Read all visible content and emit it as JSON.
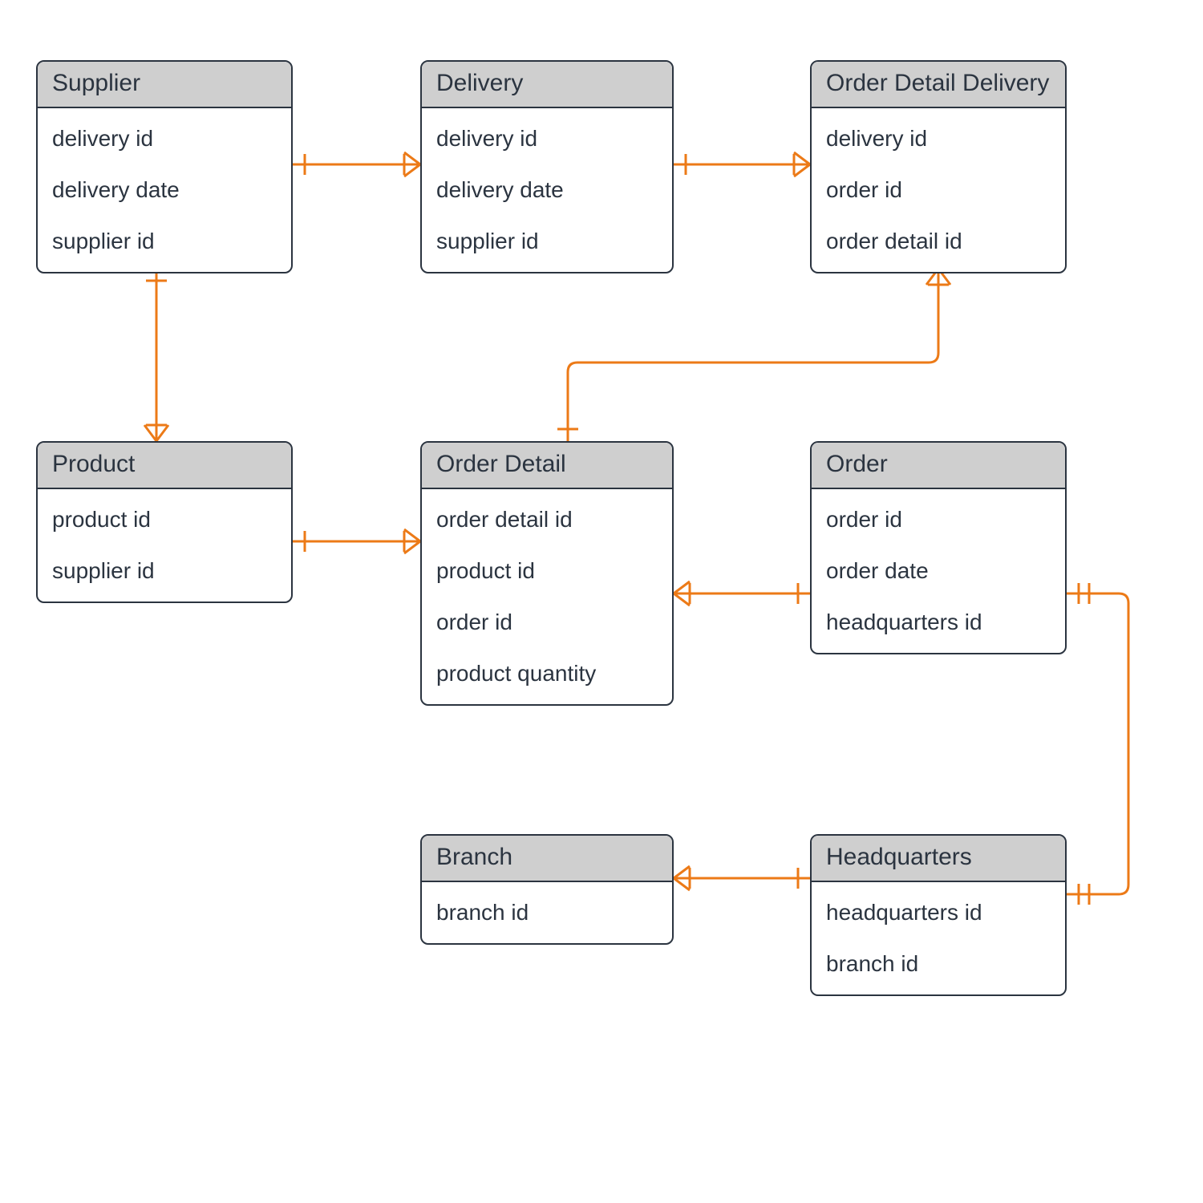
{
  "colors": {
    "connector": "#ec7a17",
    "border": "#2b3440",
    "header_bg": "#cfcfcf",
    "text": "#2b3440"
  },
  "entities": {
    "supplier": {
      "title": "Supplier",
      "attrs": [
        "delivery id",
        "delivery date",
        "supplier id"
      ]
    },
    "delivery": {
      "title": "Delivery",
      "attrs": [
        "delivery id",
        "delivery date",
        "supplier id"
      ]
    },
    "order_detail_delivery": {
      "title": "Order Detail Delivery",
      "attrs": [
        "delivery id",
        "order id",
        "order detail id"
      ]
    },
    "product": {
      "title": "Product",
      "attrs": [
        "product id",
        "supplier id"
      ]
    },
    "order_detail": {
      "title": "Order Detail",
      "attrs": [
        "order detail id",
        "product id",
        "order id",
        "product quantity"
      ]
    },
    "order": {
      "title": "Order",
      "attrs": [
        "order id",
        "order date",
        "headquarters id"
      ]
    },
    "branch": {
      "title": "Branch",
      "attrs": [
        "branch id"
      ]
    },
    "headquarters": {
      "title": "Headquarters",
      "attrs": [
        "headquarters id",
        "branch id"
      ]
    }
  },
  "relationships": [
    {
      "from": "supplier",
      "to": "delivery",
      "cardinality": "one-to-many"
    },
    {
      "from": "delivery",
      "to": "order_detail_delivery",
      "cardinality": "one-to-many"
    },
    {
      "from": "supplier",
      "to": "product",
      "cardinality": "one-to-many"
    },
    {
      "from": "product",
      "to": "order_detail",
      "cardinality": "one-to-many"
    },
    {
      "from": "order",
      "to": "order_detail",
      "cardinality": "one-to-many"
    },
    {
      "from": "order_detail",
      "to": "order_detail_delivery",
      "cardinality": "one-to-many"
    },
    {
      "from": "order",
      "to": "headquarters",
      "cardinality": "one-to-one"
    },
    {
      "from": "headquarters",
      "to": "branch",
      "cardinality": "one-to-many"
    }
  ]
}
